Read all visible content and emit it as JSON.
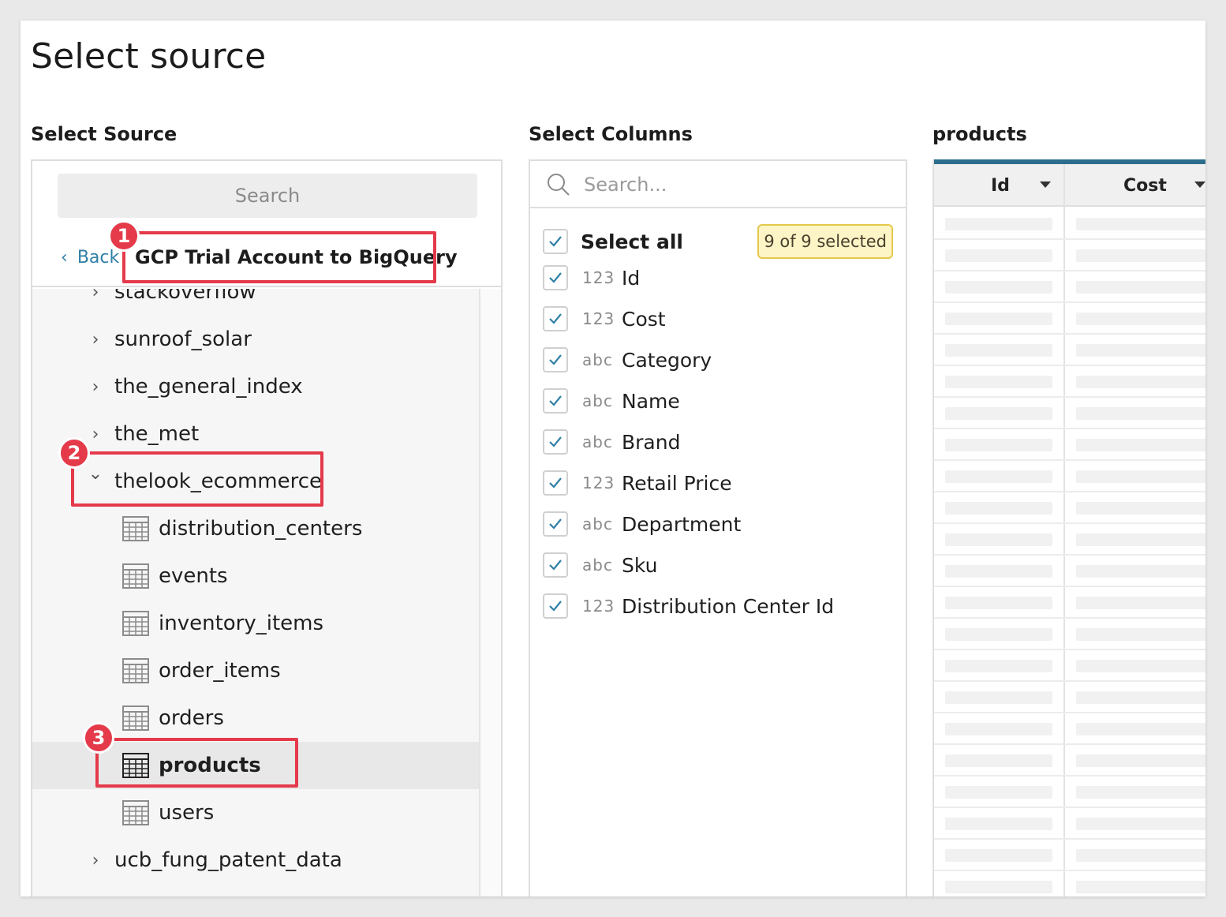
{
  "page": {
    "title": "Select source"
  },
  "sections": {
    "source_heading": "Select Source",
    "columns_heading": "Select Columns",
    "preview_heading": "products"
  },
  "source": {
    "search_placeholder": "Search",
    "back_label": "Back",
    "connection_title": "GCP Trial Account to BigQuery",
    "tree": [
      {
        "label": "stackoverflow",
        "kind": "dataset",
        "expanded": false
      },
      {
        "label": "sunroof_solar",
        "kind": "dataset",
        "expanded": false
      },
      {
        "label": "the_general_index",
        "kind": "dataset",
        "expanded": false
      },
      {
        "label": "the_met",
        "kind": "dataset",
        "expanded": false
      },
      {
        "label": "thelook_ecommerce",
        "kind": "dataset",
        "expanded": true
      },
      {
        "label": "distribution_centers",
        "kind": "table"
      },
      {
        "label": "events",
        "kind": "table"
      },
      {
        "label": "inventory_items",
        "kind": "table"
      },
      {
        "label": "order_items",
        "kind": "table"
      },
      {
        "label": "orders",
        "kind": "table"
      },
      {
        "label": "products",
        "kind": "table",
        "selected": true
      },
      {
        "label": "users",
        "kind": "table"
      },
      {
        "label": "ucb_fung_patent_data",
        "kind": "dataset",
        "expanded": false
      }
    ]
  },
  "columns": {
    "search_placeholder": "Search...",
    "select_all_label": "Select all",
    "selected_badge": "9 of 9 selected",
    "items": [
      {
        "type": "123",
        "name": "Id",
        "checked": true
      },
      {
        "type": "123",
        "name": "Cost",
        "checked": true
      },
      {
        "type": "abc",
        "name": "Category",
        "checked": true
      },
      {
        "type": "abc",
        "name": "Name",
        "checked": true
      },
      {
        "type": "abc",
        "name": "Brand",
        "checked": true
      },
      {
        "type": "123",
        "name": "Retail Price",
        "checked": true
      },
      {
        "type": "abc",
        "name": "Department",
        "checked": true
      },
      {
        "type": "abc",
        "name": "Sku",
        "checked": true
      },
      {
        "type": "123",
        "name": "Distribution Center Id",
        "checked": true
      }
    ]
  },
  "preview": {
    "headers": [
      "Id",
      "Cost"
    ]
  },
  "annotations": [
    "1",
    "2",
    "3"
  ],
  "icons": {
    "back": "chevron-left-icon",
    "collapsed": "chevron-right-icon",
    "expanded": "chevron-down-icon",
    "table": "table-icon",
    "search": "search-icon",
    "check": "checkmark-icon",
    "sort": "caret-down-icon"
  },
  "colors": {
    "accent": "#2f7fa6",
    "preview_bar": "#2d6e8d",
    "annotation": "#e43a4a",
    "badge_bg": "#fdf5c6",
    "badge_border": "#e5c84a"
  }
}
